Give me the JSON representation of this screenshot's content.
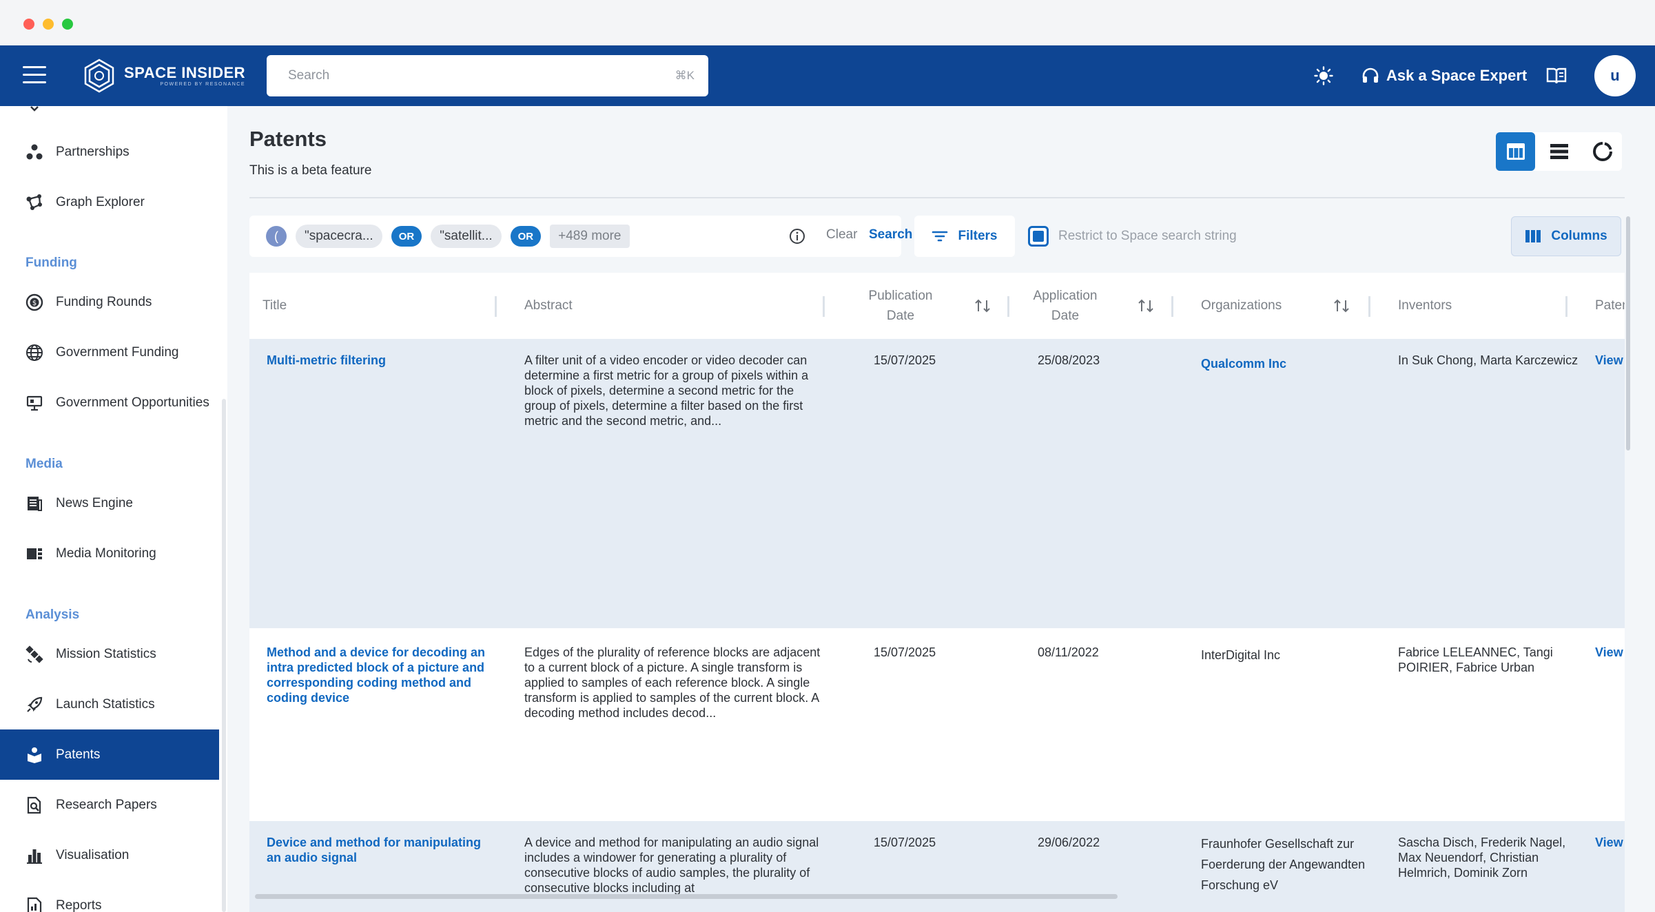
{
  "app": {
    "brand": "SPACE INSIDER",
    "brand_sub": "POWERED BY RESONANCE",
    "search_placeholder": "Search",
    "search_shortcut": "⌘K",
    "expert_label": "Ask a Space Expert",
    "avatar_initial": "u"
  },
  "sidebar": {
    "items": {
      "partnerships": "Partnerships",
      "graph_explorer": "Graph Explorer",
      "funding_rounds": "Funding Rounds",
      "government_funding": "Government Funding",
      "government_opportunities": "Government Opportunities",
      "news_engine": "News Engine",
      "media_monitoring": "Media Monitoring",
      "mission_statistics": "Mission Statistics",
      "launch_statistics": "Launch Statistics",
      "patents": "Patents",
      "research_papers": "Research Papers",
      "visualisation": "Visualisation",
      "reports": "Reports"
    },
    "sections": {
      "funding": "Funding",
      "media": "Media",
      "analysis": "Analysis"
    },
    "active": "patents"
  },
  "page": {
    "title": "Patents",
    "subtitle": "This is a beta feature"
  },
  "query": {
    "paren": "(",
    "term1": "\"spacecra...",
    "op1": "OR",
    "term2": "\"satellit...",
    "op2": "OR",
    "more": "+489 more",
    "clear_label": "Clear",
    "search_label": "Search"
  },
  "toolbar": {
    "filters_label": "Filters",
    "restrict_label": "Restrict to Space search string",
    "restrict_checked": true,
    "columns_label": "Columns"
  },
  "table": {
    "headers": {
      "title": "Title",
      "abstract": "Abstract",
      "pub_date_1": "Publication",
      "pub_date_2": "Date",
      "app_date_1": "Application",
      "app_date_2": "Date",
      "organizations": "Organizations",
      "inventors": "Inventors",
      "patent": "Patent P"
    },
    "rows": [
      {
        "title": "Multi-metric filtering",
        "abstract": "A filter unit of a video encoder or video decoder can determine a first metric for a group of pixels within a block of pixels, determine a second metric for the group of pixels, determine a filter based on the first metric and the second metric, and...",
        "publication_date": "15/07/2025",
        "application_date": "25/08/2023",
        "organization": "Qualcomm Inc",
        "inventors": "In Suk Chong, Marta Karczewicz",
        "link": "View Pa"
      },
      {
        "title": "Method and a device for decoding an intra predicted block of a picture and corresponding coding method and coding device",
        "abstract": "Edges of the plurality of reference blocks are adjacent to a current block of a picture. A single transform is applied to samples of each reference block. A single transform is applied to samples of the current block. A decoding method includes decod...",
        "publication_date": "15/07/2025",
        "application_date": "08/11/2022",
        "organization": "InterDigital Inc",
        "inventors": "Fabrice LELEANNEC, Tangi POIRIER, Fabrice Urban",
        "link": "View Pa"
      },
      {
        "title": "Device and method for manipulating an audio signal",
        "abstract": "A device and method for manipulating an audio signal includes a windower for generating a plurality of consecutive blocks of audio samples, the plurality of consecutive blocks including at",
        "publication_date": "15/07/2025",
        "application_date": "29/06/2022",
        "organization": "Fraunhofer Gesellschaft zur Foerderung der Angewandten Forschung eV",
        "inventors": "Sascha Disch, Frederik Nagel, Max Neuendorf, Christian Helmrich, Dominik Zorn",
        "link": "View Pa"
      }
    ]
  },
  "colors": {
    "brand_blue": "#0e4593",
    "accent_blue": "#1168c0",
    "section_blue": "#5b8fd6",
    "row_shade": "#e5ecf4"
  }
}
